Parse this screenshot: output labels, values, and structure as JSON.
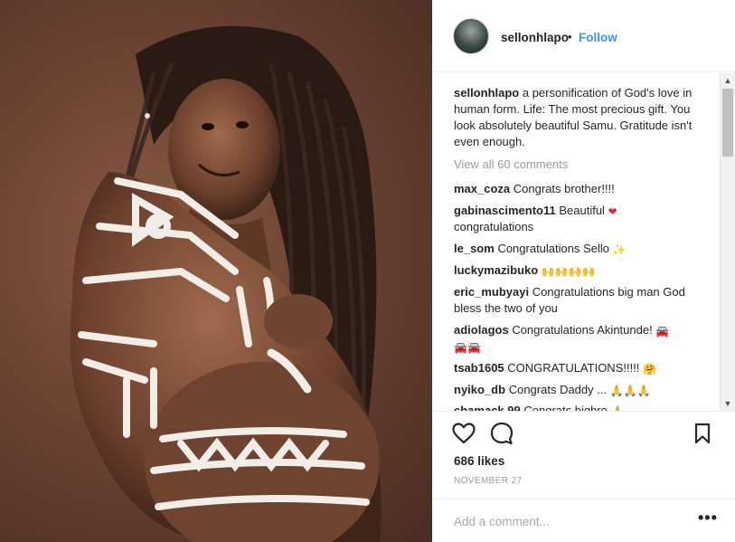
{
  "post": {
    "username": "sellonhlapo",
    "dot": "•",
    "follow_label": "Follow",
    "caption_user": "sellonhlapo",
    "caption_text": "a personification of God's love in human form. Life: The most precious gift. You look absolutely beautiful Samu. Gratitude isn't even enough.",
    "view_all": "View all 60 comments",
    "likes": "686 likes",
    "date": "NOVEMBER 27",
    "add_comment_placeholder": "Add a comment...",
    "more_label": "•••"
  },
  "comments": [
    {
      "user": "max_coza",
      "text": "Congrats brother!!!!",
      "emoji": ""
    },
    {
      "user": "gabinascimento11",
      "text": "Beautiful",
      "emoji": "❤",
      "emoji_class": "heart",
      "tail": "congratulations"
    },
    {
      "user": "le_som",
      "text": "Congratulations Sello",
      "emoji": "✨",
      "emoji_class": "sparkle"
    },
    {
      "user": "luckymazibuko",
      "text": "",
      "emoji": "🙌🙌🙌🙌"
    },
    {
      "user": "eric_mubyayi",
      "text": "Congratulations big man God bless the two of you",
      "emoji": ""
    },
    {
      "user": "adiolagos",
      "text": "Congratulations Akintunde!",
      "emoji": "🚘",
      "tail": "🚘🚘"
    },
    {
      "user": "tsab1605",
      "text": "CONGRATULATIONS!!!!!",
      "emoji": "🤗"
    },
    {
      "user": "nyiko_db",
      "text": "Congrats Daddy ...",
      "emoji": "🙏🙏🙏"
    },
    {
      "user": "chamack.99",
      "text": "Congrats bighro",
      "emoji": "🙏"
    }
  ],
  "icons": {
    "like": "heart-outline-icon",
    "comment": "speech-bubble-icon",
    "save": "bookmark-icon",
    "scroll_up": "▲",
    "scroll_down": "▼"
  },
  "colors": {
    "follow": "#3897f0",
    "muted": "#999999",
    "text": "#262626"
  }
}
